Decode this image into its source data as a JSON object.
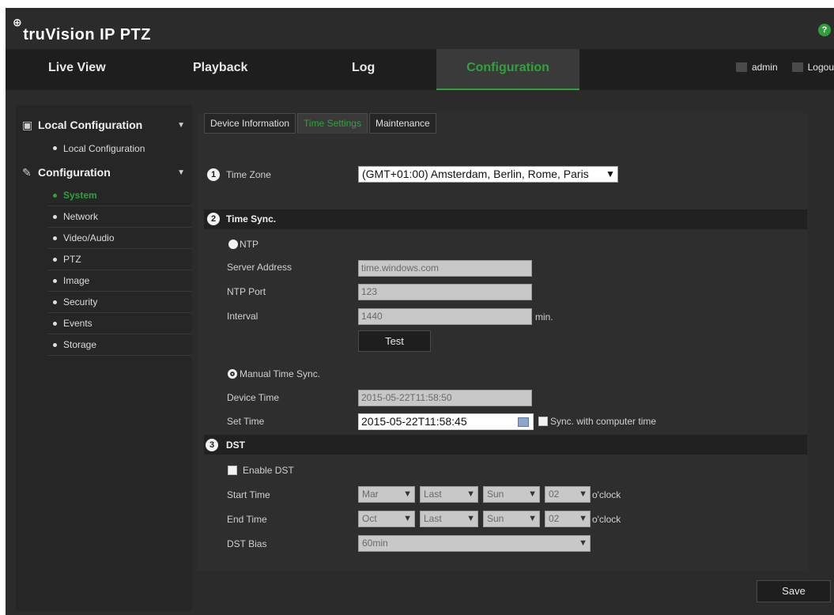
{
  "header": {
    "brand": "truVision IP PTZ",
    "help_glyph": "?"
  },
  "nav": {
    "tabs": [
      "Live View",
      "Playback",
      "Log",
      "Configuration"
    ],
    "active": "Configuration",
    "user": "admin",
    "logout": "Logou"
  },
  "sidebar": {
    "groups": [
      {
        "label": "Local Configuration",
        "icon": "local-config-icon",
        "items": [
          "Local Configuration"
        ]
      },
      {
        "label": "Configuration",
        "icon": "wrench-icon",
        "items": [
          "System",
          "Network",
          "Video/Audio",
          "PTZ",
          "Image",
          "Security",
          "Events",
          "Storage"
        ]
      }
    ],
    "active_item": "System"
  },
  "subtabs": [
    "Device Information",
    "Time Settings",
    "Maintenance"
  ],
  "active_subtab": "Time Settings",
  "time_zone": {
    "marker": "1",
    "label": "Time Zone",
    "value": "(GMT+01:00) Amsterdam, Berlin, Rome, Paris"
  },
  "time_sync": {
    "marker": "2",
    "title": "Time Sync.",
    "ntp_label": "NTP",
    "server_label": "Server Address",
    "server_value": "time.windows.com",
    "port_label": "NTP Port",
    "port_value": "123",
    "interval_label": "Interval",
    "interval_value": "1440",
    "interval_unit": "min.",
    "test_label": "Test",
    "manual_label": "Manual Time Sync.",
    "device_time_label": "Device Time",
    "device_time_value": "2015-05-22T11:58:50",
    "set_time_label": "Set Time",
    "set_time_value": "2015-05-22T11:58:45",
    "sync_computer_label": "Sync. with computer time"
  },
  "dst": {
    "marker": "3",
    "title": "DST",
    "enable_label": "Enable DST",
    "start_label": "Start Time",
    "end_label": "End Time",
    "bias_label": "DST Bias",
    "start": {
      "month": "Mar",
      "week": "Last",
      "day": "Sun",
      "hour": "02"
    },
    "end": {
      "month": "Oct",
      "week": "Last",
      "day": "Sun",
      "hour": "02"
    },
    "oclock": "o'clock",
    "bias_value": "60min"
  },
  "save_label": "Save",
  "colors": {
    "accent": "#2fa33a",
    "background": "#2b2b2b",
    "panel": "#2e2e2e"
  }
}
